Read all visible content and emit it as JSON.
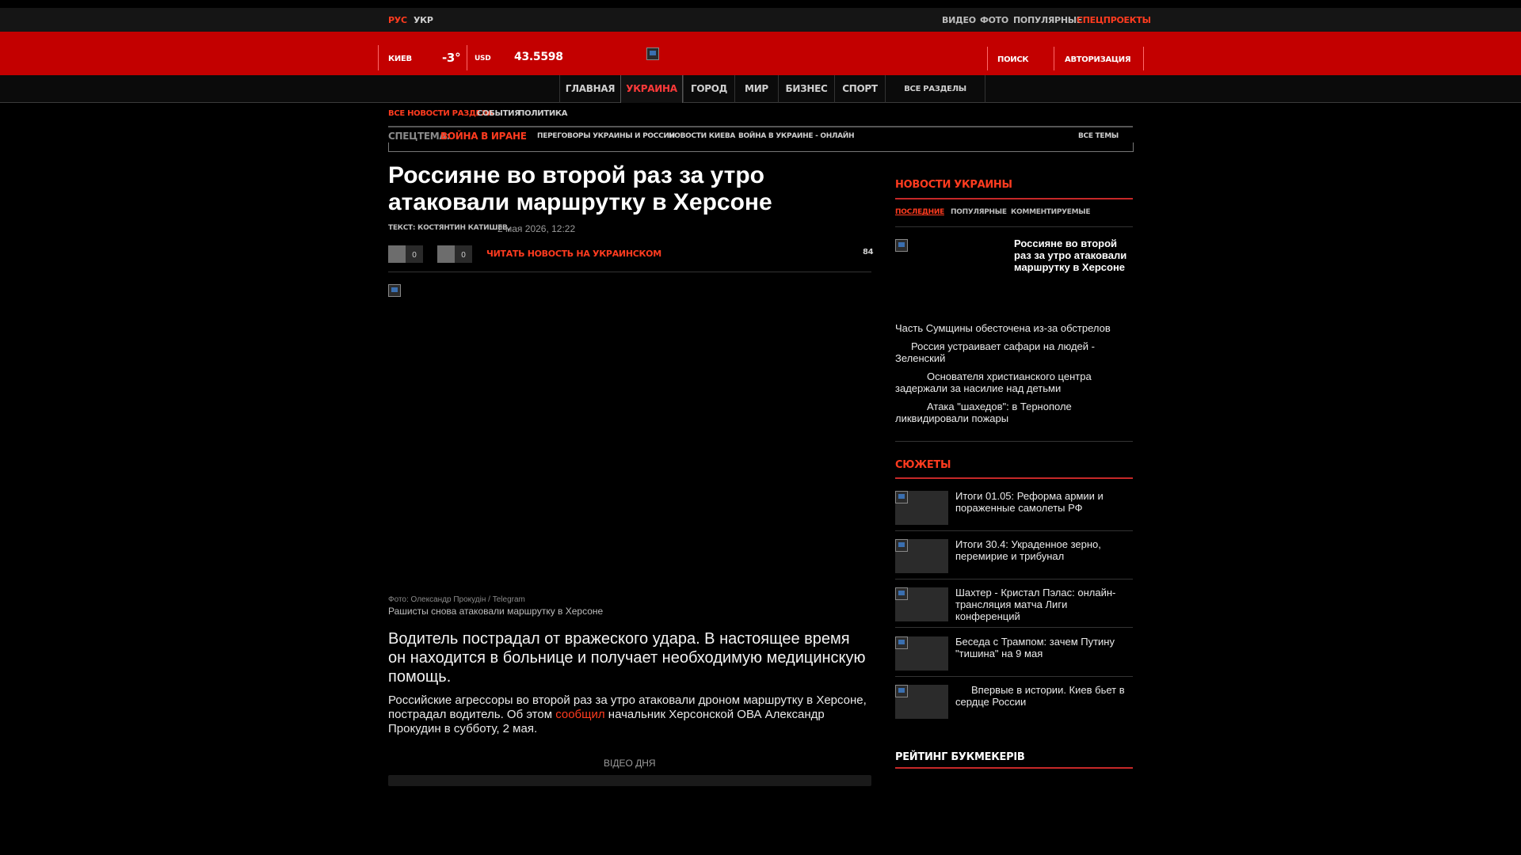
{
  "top": {
    "lang_ru": "РУС",
    "lang_ua": "УКР",
    "links": [
      "ВИДЕО",
      "ФОТО",
      "ПОПУЛЯРНЫЕ",
      "СПЕЦПРОЕКТЫ"
    ]
  },
  "header": {
    "city": "КИЕВ",
    "temperature": "-3°",
    "currency": "USD",
    "rate": "43.5598",
    "search": "ПОИСК",
    "auth": "АВТОРИЗАЦИЯ"
  },
  "nav": {
    "items": [
      "ГЛАВНАЯ",
      "УКРАИНА",
      "ГОРОД",
      "МИР",
      "БИЗНЕС",
      "СПОРТ"
    ],
    "all_sections": "ВСЕ РАЗДЕЛЫ"
  },
  "subnav": [
    "ВСЕ НОВОСТИ РАЗДЕЛА",
    "СОБЫТИЯ",
    "ПОЛИТИКА"
  ],
  "special": {
    "label": "СПЕЦТЕМА:",
    "topic": "ВОЙНА В ИРАНЕ",
    "links": [
      "ПЕРЕГОВОРЫ УКРАИНЫ И РОССИИ",
      "НОВОСТИ КИЕВА",
      "ВОЙНА В УКРАИНЕ - ОНЛАЙН"
    ],
    "all": "ВСЕ ТЕМЫ"
  },
  "article": {
    "title": "Россияне во второй раз за утро атаковали маршрутку в Херсоне",
    "author": "ТЕКСТ: КОСТЯНТИН КАТИШЕВ,",
    "date": "2 мая 2026, 12:22",
    "count1": "0",
    "count2": "0",
    "read_ua": "ЧИТАТЬ НОВОСТЬ НА УКРАИНСКОМ",
    "views": "84",
    "photo_credit": "Фото: Олександр Прокудін / Telegram",
    "caption": "Рашисты снова атаковали маршрутку в Херсоне",
    "lead": "Водитель пострадал от вражеского удара. В настоящее время он находится в больнице и получает необходимую медицинскую помощь.",
    "body_part1": "Российские агрессоры во второй раз за утро атаковали дроном маршрутку в Херсоне, пострадал водитель. Об этом ",
    "body_link": "сообщил",
    "body_part2": " начальник Херсонской ОВА Александр Прокудин в субботу, 2 мая.",
    "video_day": "ВІДЕО ДНЯ"
  },
  "sidebar": {
    "news_title": "НОВОСТИ УКРАИНЫ",
    "tabs": [
      "ПОСЛЕДНИЕ",
      "ПОПУЛЯРНЫЕ",
      "КОММЕНТИРУЕМЫЕ"
    ],
    "featured": "Россияне во второй раз за утро атаковали маршрутку в Херсоне",
    "news": [
      "Часть Сумщины обесточена из-за обстрелов",
      "Россия устраивает сафари на людей - Зеленский",
      "Основателя христианского центра задержали за насилие над детьми",
      "Атака \"шахедов\": в Тернополе ликвидировали пожары"
    ],
    "stories_title": "СЮЖЕТЫ",
    "stories": [
      "Итоги 01.05: Реформа армии и пораженные самолеты РФ",
      "Итоги 30.4: Украденное зерно, перемирие и трибунал",
      "Шахтер - Кристал Пэлас: онлайн-трансляция матча Лиги конференций",
      "Беседа с Трампом: зачем Путину \"тишина\" на 9 мая",
      "Впервые в истории. Киев бьет в сердце России"
    ],
    "rating_title": "РЕЙТИНГ БУКМЕКЕРІВ"
  },
  "colors": {
    "brand_red": "#c30000",
    "accent": "#ff3b1f"
  }
}
